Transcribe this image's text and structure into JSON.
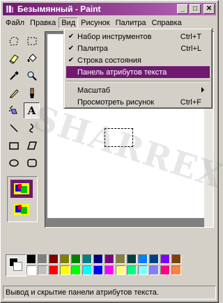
{
  "window": {
    "title": "Безымянный - Paint",
    "minimize_label": "_",
    "maximize_label": "□",
    "close_label": "✕"
  },
  "menubar": {
    "items": [
      "Файл",
      "Правка",
      "Вид",
      "Рисунок",
      "Палитра",
      "Справка"
    ],
    "open_index": 2
  },
  "view_menu": {
    "items": [
      {
        "label": "Набор инструментов",
        "shortcut": "Ctrl+T",
        "checked": true
      },
      {
        "label": "Палитра",
        "shortcut": "Ctrl+L",
        "checked": true
      },
      {
        "label": "Строка состояния",
        "shortcut": "",
        "checked": true
      },
      {
        "label": "Панель атрибутов текста",
        "shortcut": "",
        "checked": false,
        "highlighted": true
      },
      {
        "label": "Масштаб",
        "shortcut": "",
        "checked": false,
        "submenu": true
      },
      {
        "label": "Просмотреть рисунок",
        "shortcut": "Ctrl+F",
        "checked": false
      }
    ]
  },
  "toolbox": {
    "tools": [
      "free-select",
      "rect-select",
      "eraser",
      "fill",
      "pick-color",
      "magnifier",
      "pencil",
      "brush",
      "airbrush",
      "text",
      "line",
      "curve",
      "rectangle",
      "polygon",
      "ellipse",
      "rounded-rect"
    ],
    "pressed": "text",
    "text_glyph": "A"
  },
  "palette": {
    "colors": [
      "#000000",
      "#808080",
      "#800000",
      "#808000",
      "#008000",
      "#008080",
      "#000080",
      "#800080",
      "#808040",
      "#004040",
      "#0080ff",
      "#004080",
      "#8000ff",
      "#804000",
      "#ffffff",
      "#c0c0c0",
      "#ff0000",
      "#ffff00",
      "#00ff00",
      "#00ffff",
      "#0000ff",
      "#ff00ff",
      "#ffff80",
      "#00ff80",
      "#80ffff",
      "#8080ff",
      "#ff0080",
      "#ff8040"
    ],
    "foreground": "#000000",
    "background": "#ffffff"
  },
  "statusbar": {
    "text": "Вывод и скрытие панели атрибутов текста."
  },
  "watermark": "SHARREX.RU",
  "accent_color": "#6f1a6f"
}
